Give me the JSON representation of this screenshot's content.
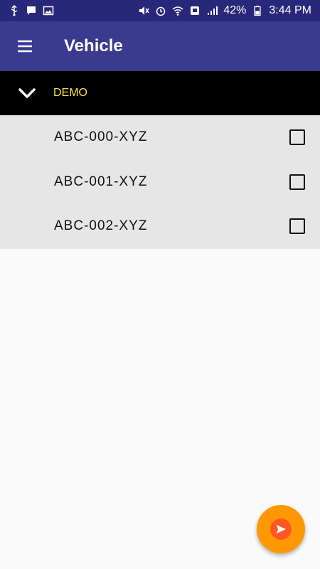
{
  "status_bar": {
    "battery_percent": "42%",
    "time": "3:44 PM",
    "left_icons": [
      "usb-icon",
      "message-icon",
      "image-icon"
    ],
    "right_icons": [
      "mute-icon",
      "alarm-icon",
      "wifi-icon",
      "sync-icon",
      "signal-icon"
    ]
  },
  "app_bar": {
    "title": "Vehicle"
  },
  "group": {
    "label": "DEMO"
  },
  "vehicles": [
    {
      "label": "ABC-000-XYZ",
      "checked": false
    },
    {
      "label": "ABC-001-XYZ",
      "checked": false
    },
    {
      "label": "ABC-002-XYZ",
      "checked": false
    }
  ],
  "colors": {
    "status_bar": "#28287a",
    "app_bar": "#3a3a8f",
    "group_header": "#000000",
    "group_label": "#f2e34a",
    "list_bg": "#e6e6e6",
    "fab": "#ff9800",
    "fab_inner": "#ff5722"
  }
}
